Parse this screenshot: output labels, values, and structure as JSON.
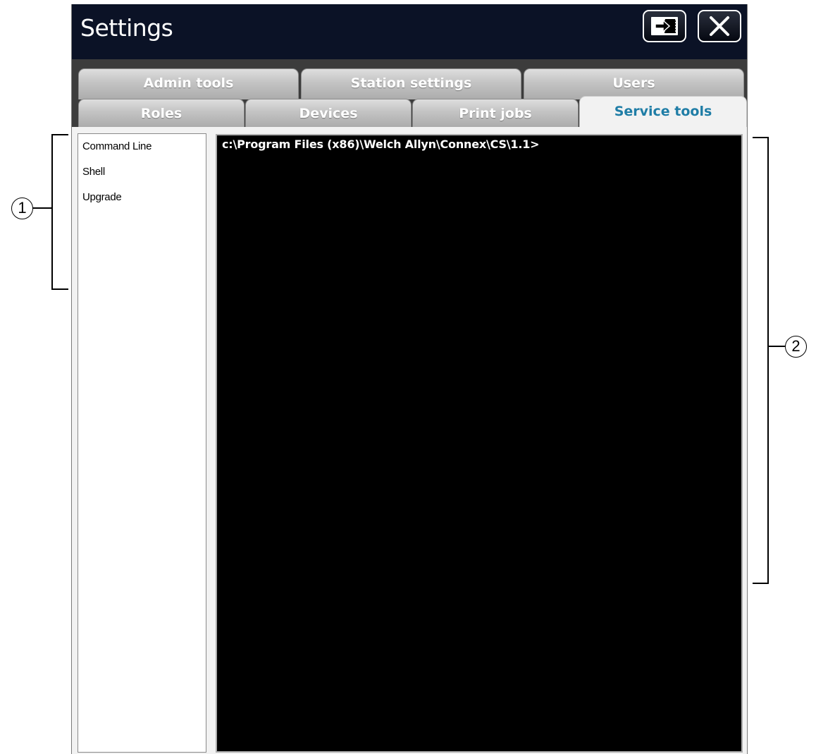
{
  "window": {
    "title": "Settings",
    "exit_button": {
      "icon": "exit-icon"
    },
    "close_button": {
      "icon": "close-icon"
    }
  },
  "tabs": {
    "row1": [
      {
        "label": "Admin tools"
      },
      {
        "label": "Station settings"
      },
      {
        "label": "Users"
      }
    ],
    "row2": [
      {
        "label": "Roles"
      },
      {
        "label": "Devices"
      },
      {
        "label": "Print jobs"
      },
      {
        "label": "Service tools",
        "active": true
      }
    ]
  },
  "sidebar": {
    "items": [
      {
        "label": "Command Line"
      },
      {
        "label": "Shell"
      },
      {
        "label": "Upgrade"
      }
    ]
  },
  "console": {
    "prompt": "c:\\Program Files (x86)\\Welch Allyn\\Connex\\CS\\1.1>"
  },
  "callouts": [
    {
      "number": "1"
    },
    {
      "number": "2"
    }
  ],
  "colors": {
    "titlebar": "#0b1226",
    "active_tab_text": "#1f7da6",
    "console_bg": "#000000"
  }
}
